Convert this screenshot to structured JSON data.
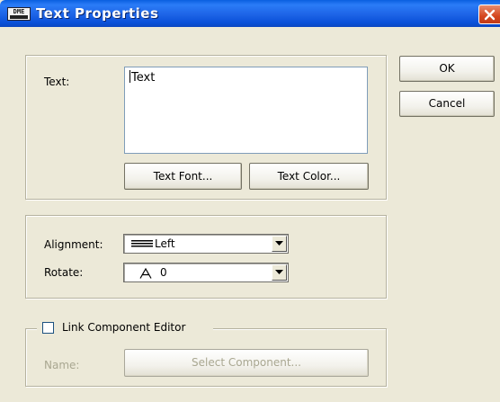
{
  "window": {
    "title": "Text Properties",
    "icon_text": "DME",
    "accent_color": "#0A5FE0",
    "close_icon": "close-icon"
  },
  "buttons": {
    "ok": "OK",
    "cancel": "Cancel"
  },
  "text_group": {
    "label": "Text:",
    "value": "Text",
    "font_button": "Text Font...",
    "color_button": "Text Color..."
  },
  "layout_group": {
    "alignment_label": "Alignment:",
    "alignment_value": "Left",
    "alignment_icon": "align-left-icon",
    "rotate_label": "Rotate:",
    "rotate_value": "0",
    "rotate_icon": "rotate-a-icon"
  },
  "link_group": {
    "checkbox_label": "Link Component Editor",
    "checked": false,
    "name_label": "Name:",
    "select_button": "Select Component..."
  }
}
